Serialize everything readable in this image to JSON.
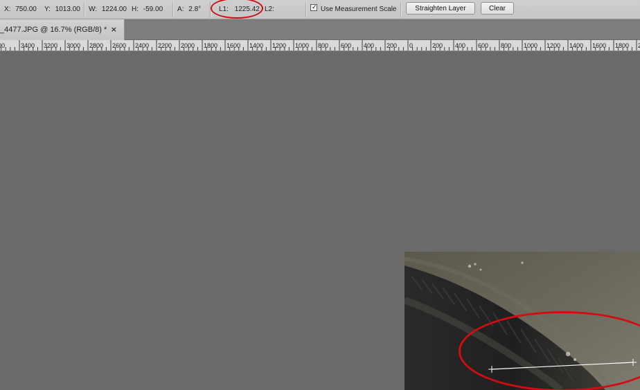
{
  "options": {
    "x_label": "X:",
    "x_value": "750.00",
    "y_label": "Y:",
    "y_value": "1013.00",
    "w_label": "W:",
    "w_value": "1224.00",
    "h_label": "H:",
    "h_value": "-59.00",
    "a_label": "A:",
    "a_value": "2.8°",
    "l1_label": "L1:",
    "l1_value": "1225.42",
    "l2_label": "L2:",
    "use_measurement_scale_label": "Use Measurement Scale",
    "use_measurement_scale_checked": true,
    "straighten_layer_label": "Straighten Layer",
    "clear_label": "Clear"
  },
  "document_tab": {
    "title": "_4477.JPG @ 16.7% (RGB/8) *",
    "close_glyph": "×"
  },
  "ruler": {
    "ticks": [
      "00",
      "3400",
      "3200",
      "3000",
      "2800",
      "2600",
      "2400",
      "2200",
      "2000",
      "1800",
      "1600",
      "1400",
      "1200",
      "1000",
      "800",
      "600",
      "400",
      "200",
      "0",
      "200",
      "400",
      "600",
      "800",
      "1000",
      "1200",
      "1400",
      "1600",
      "1800",
      "20"
    ]
  },
  "icons": {
    "checkbox_icon": "check-icon",
    "close_icon": "close-icon"
  },
  "colors": {
    "annotation": "#d10d12",
    "canvas_bg": "#6a6a6a"
  }
}
